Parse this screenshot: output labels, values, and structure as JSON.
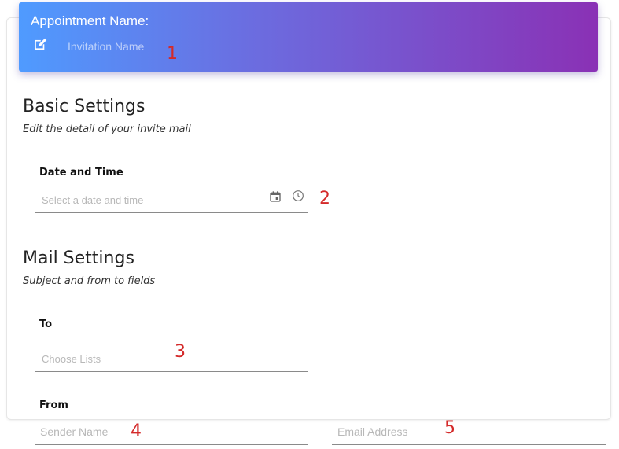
{
  "header": {
    "title": "Appointment Name:",
    "name_placeholder": "Invitation Name",
    "edit_icon": "edit-icon"
  },
  "basic_settings": {
    "title": "Basic Settings",
    "subtitle": "Edit the detail of your invite mail",
    "date_time": {
      "label": "Date and Time",
      "placeholder": "Select a date and time",
      "value": "",
      "icons": [
        "calendar-icon",
        "clock-icon"
      ]
    }
  },
  "mail_settings": {
    "title": "Mail Settings",
    "subtitle": "Subject and from to fields",
    "to": {
      "label": "To",
      "placeholder": "Choose Lists",
      "value": ""
    },
    "from": {
      "label": "From",
      "sender_placeholder": "Sender Name",
      "sender_value": "",
      "email_placeholder": "Email Address",
      "email_value": ""
    }
  },
  "annotations": [
    "1",
    "2",
    "3",
    "4",
    "5"
  ],
  "colors": {
    "gradient_start": "#4f9bff",
    "gradient_end": "#8a31b5",
    "annotation": "#d42a2a"
  }
}
